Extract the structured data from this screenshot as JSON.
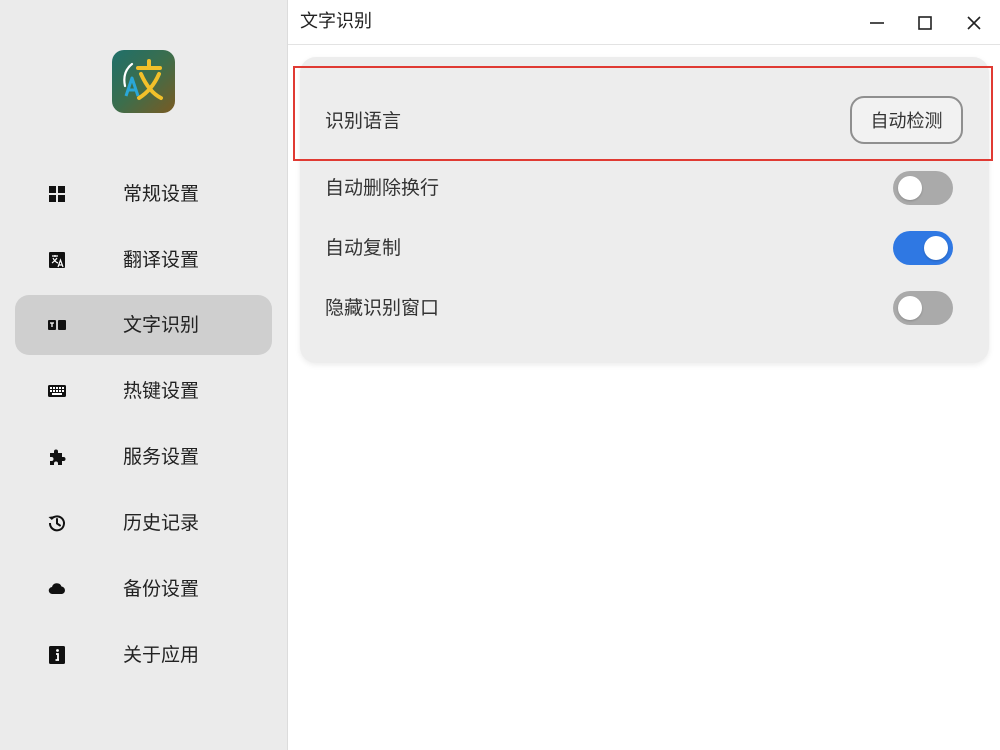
{
  "window": {
    "title": "文字识别"
  },
  "sidebar": {
    "items": [
      {
        "label": "常规设置",
        "icon": "grid-icon"
      },
      {
        "label": "翻译设置",
        "icon": "translate-icon"
      },
      {
        "label": "文字识别",
        "icon": "ocr-icon",
        "active": true
      },
      {
        "label": "热键设置",
        "icon": "keyboard-icon"
      },
      {
        "label": "服务设置",
        "icon": "puzzle-icon"
      },
      {
        "label": "历史记录",
        "icon": "history-icon"
      },
      {
        "label": "备份设置",
        "icon": "cloud-icon"
      },
      {
        "label": "关于应用",
        "icon": "info-icon"
      }
    ]
  },
  "settings": {
    "language": {
      "label": "识别语言",
      "value": "自动检测"
    },
    "delete_newline": {
      "label": "自动删除换行",
      "enabled": false
    },
    "auto_copy": {
      "label": "自动复制",
      "enabled": true
    },
    "hide_window": {
      "label": "隐藏识别窗口",
      "enabled": false
    }
  },
  "colors": {
    "accent": "#2f78e3",
    "highlight_border": "#e03a33",
    "sidebar_bg": "#ebebeb",
    "active_item_bg": "#cfcfcf",
    "toggle_off": "#aaaaaa"
  }
}
